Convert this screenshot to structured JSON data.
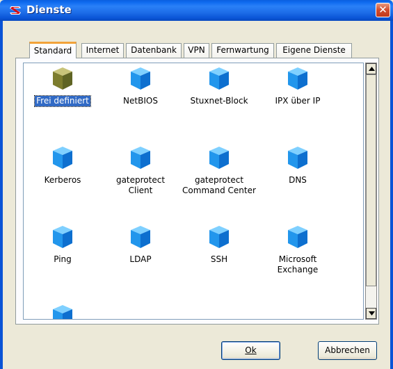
{
  "window": {
    "title": "Dienste",
    "close_label": "✕"
  },
  "tabs": [
    {
      "label": "Standard",
      "active": true
    },
    {
      "label": "Internet",
      "active": false
    },
    {
      "label": "Datenbank",
      "active": false
    },
    {
      "label": "VPN",
      "active": false
    },
    {
      "label": "Fernwartung",
      "active": false
    },
    {
      "label": "Eigene Dienste",
      "active": false
    }
  ],
  "services": [
    {
      "label": "Frei definiert",
      "icon": "custom-cube-icon",
      "selected": true
    },
    {
      "label": "NetBIOS",
      "icon": "service-cube-icon"
    },
    {
      "label": "Stuxnet-Block",
      "icon": "service-cube-icon"
    },
    {
      "label": "IPX über IP",
      "icon": "service-cube-icon"
    },
    {
      "label": "Kerberos",
      "icon": "service-cube-icon"
    },
    {
      "label": "gateprotect\nClient",
      "icon": "service-cube-icon"
    },
    {
      "label": "gateprotect\nCommand Center",
      "icon": "service-cube-icon"
    },
    {
      "label": "DNS",
      "icon": "service-cube-icon"
    },
    {
      "label": "Ping",
      "icon": "service-cube-icon"
    },
    {
      "label": "LDAP",
      "icon": "service-cube-icon"
    },
    {
      "label": "SSH",
      "icon": "service-cube-icon"
    },
    {
      "label": "Microsoft\nExchange",
      "icon": "service-cube-icon"
    },
    {
      "label": "",
      "icon": "service-cube-icon"
    }
  ],
  "buttons": {
    "ok": "Ok",
    "cancel": "Abbrechen"
  },
  "colors": {
    "titlebar": "#0a5fe0",
    "selection": "#316ac5",
    "active_tab_accent": "#f2a33a",
    "cube_blue": "#1a8fe8",
    "cube_custom": "#8a8c3a"
  }
}
